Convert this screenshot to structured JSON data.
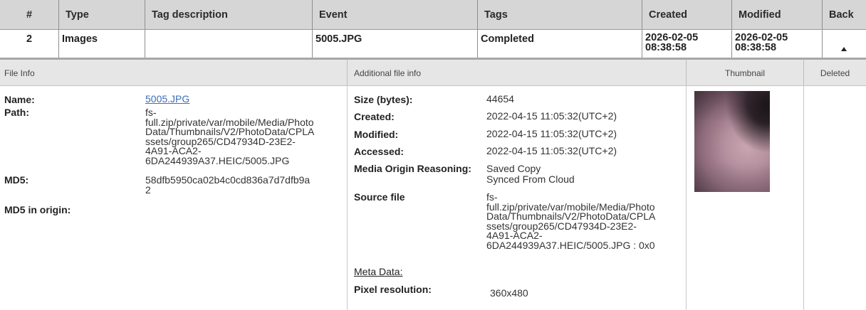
{
  "table": {
    "headers": [
      "#",
      "Type",
      "Tag description",
      "Event",
      "Tags",
      "Created",
      "Modified",
      "Back"
    ],
    "row": {
      "index": "2",
      "type": "Images",
      "tag_description": "",
      "event": "5005.JPG",
      "tags": "Completed",
      "created": [
        "2026-02-05",
        "08:38:58"
      ],
      "modified": [
        "2026-02-05",
        "08:38:58"
      ],
      "back_icon": "up-arrow-icon"
    }
  },
  "panel": {
    "headers": {
      "file_info": "File Info",
      "additional": "Additional file info",
      "thumbnail": "Thumbnail",
      "deleted": "Deleted"
    },
    "file_info": {
      "name_label": "Name:",
      "name_value": "5005.JPG",
      "path_label": "Path:",
      "path_lines": [
        "fs-",
        "full.zip/private/var/mobile/Media/Photo",
        "Data/Thumbnails/V2/PhotoData/CPLA",
        "ssets/group265/CD47934D-23E2-",
        "4A91-ACA2-",
        "6DA244939A37.HEIC/5005.JPG"
      ],
      "md5_label": "MD5:",
      "md5_lines": [
        "58dfb5950ca02b4c0cd836a7d7dfb9a",
        "2"
      ],
      "md5_origin_label": "MD5 in origin:"
    },
    "additional": {
      "size_label": "Size (bytes):",
      "size_value": "44654",
      "created_label": "Created:",
      "created_value": "2022-04-15 11:05:32(UTC+2)",
      "modified_label": "Modified:",
      "modified_value": "2022-04-15 11:05:32(UTC+2)",
      "accessed_label": "Accessed:",
      "accessed_value": "2022-04-15 11:05:32(UTC+2)",
      "origin_label": "Media Origin Reasoning:",
      "origin_lines": [
        "Saved Copy",
        "Synced From Cloud"
      ],
      "source_label": "Source file",
      "source_lines": [
        "fs-",
        "full.zip/private/var/mobile/Media/Photo",
        "Data/Thumbnails/V2/PhotoData/CPLA",
        "ssets/group265/CD47934D-23E2-",
        "4A91-ACA2-",
        "6DA244939A37.HEIC/5005.JPG : 0x0"
      ],
      "meta_label": "Meta Data:",
      "pixel_label": "Pixel resolution:",
      "pixel_value": "360x480"
    },
    "thumbnail_icon": "photo-thumbnail"
  }
}
